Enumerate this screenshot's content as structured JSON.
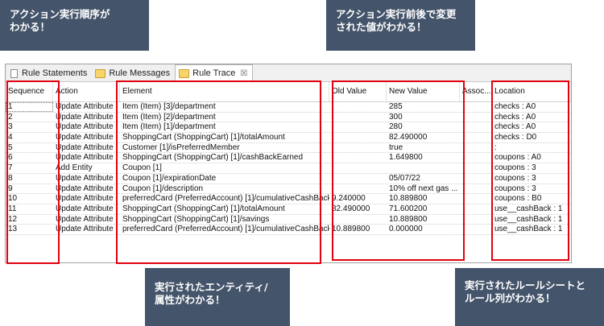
{
  "callouts": {
    "sequence": [
      "アクション実行順序が",
      "わかる！"
    ],
    "values": [
      "アクション実行前後で変更",
      "された値がわかる！"
    ],
    "entity": [
      "実行されたエンティティ/",
      "属性がわかる！"
    ],
    "location": [
      "実行されたルールシートと",
      "ルール列がわかる！"
    ]
  },
  "tabs": [
    {
      "label": "Rule Statements",
      "icon": "document-icon"
    },
    {
      "label": "Rule Messages",
      "icon": "folder-icon"
    },
    {
      "label": "Rule Trace",
      "icon": "folder-icon",
      "close": "☒"
    }
  ],
  "columns": [
    "Sequence",
    "Action",
    "Element",
    "Old Value",
    "New Value",
    "Assoc...",
    "Location"
  ],
  "rows": [
    [
      "1",
      "Update Attribute",
      "Item (Item) [3]/department",
      "",
      "285",
      "",
      "checks : A0"
    ],
    [
      "2",
      "Update Attribute",
      "Item (Item) [2]/department",
      "",
      "300",
      "",
      "checks : A0"
    ],
    [
      "3",
      "Update Attribute",
      "Item (Item) [1]/department",
      "",
      "280",
      "",
      "checks : A0"
    ],
    [
      "4",
      "Update Attribute",
      "ShoppingCart (ShoppingCart) [1]/totalAmount",
      "",
      "82.490000",
      "",
      "checks : D0"
    ],
    [
      "5",
      "Update Attribute",
      "Customer [1]/isPreferredMember",
      "",
      "true",
      "",
      ":"
    ],
    [
      "6",
      "Update Attribute",
      "ShoppingCart (ShoppingCart) [1]/cashBackEarned",
      "",
      "1.649800",
      "",
      "coupons : A0"
    ],
    [
      "7",
      "Add Entity",
      "Coupon [1]",
      "",
      "",
      "",
      "coupons : 3"
    ],
    [
      "8",
      "Update Attribute",
      "Coupon [1]/expirationDate",
      "",
      "05/07/22",
      "",
      "coupons : 3"
    ],
    [
      "9",
      "Update Attribute",
      "Coupon [1]/description",
      "",
      "10% off next gas ...",
      "",
      "coupons : 3"
    ],
    [
      "10",
      "Update Attribute",
      "preferredCard (PreferredAccount) [1]/cumulativeCashBack",
      "9.240000",
      "10.889800",
      "",
      "coupons : B0"
    ],
    [
      "11",
      "Update Attribute",
      "ShoppingCart (ShoppingCart) [1]/totalAmount",
      "82.490000",
      "71.600200",
      "",
      "use__cashBack : 1"
    ],
    [
      "12",
      "Update Attribute",
      "ShoppingCart (ShoppingCart) [1]/savings",
      "",
      "10.889800",
      "",
      "use__cashBack : 1"
    ],
    [
      "13",
      "Update Attribute",
      "preferredCard (PreferredAccount) [1]/cumulativeCashBack",
      "10.889800",
      "0.000000",
      "",
      "use__cashBack : 1"
    ]
  ],
  "highlight_color": "#e3000f",
  "callout_color": "#44546a"
}
